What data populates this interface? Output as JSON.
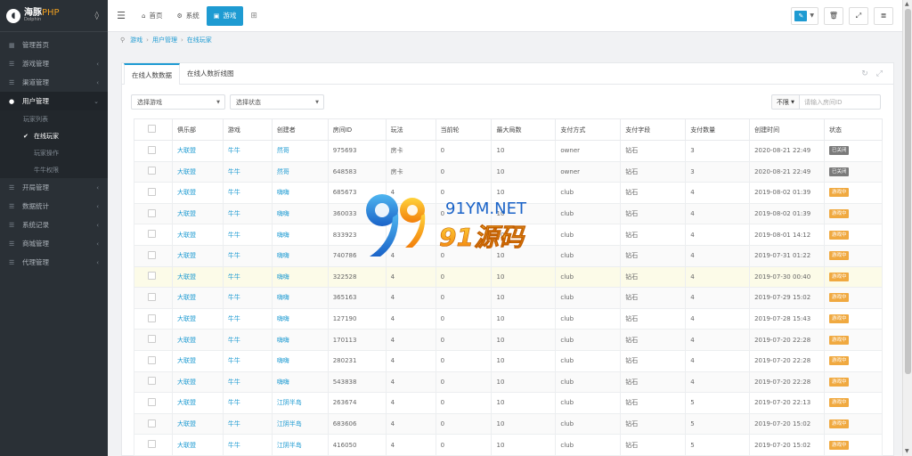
{
  "brand": {
    "name": "海豚",
    "suffix": "PHP",
    "sub": "Dolphin"
  },
  "colors": {
    "accent": "#1e9bd2",
    "closed": "#7a7a7a",
    "gaming": "#f0a940",
    "sidebar": "#2a3036"
  },
  "sidebar": {
    "items": [
      {
        "label": "管理首页",
        "icon": "grid-icon"
      },
      {
        "label": "游戏管理",
        "icon": "list-icon"
      },
      {
        "label": "渠道管理",
        "icon": "list-icon"
      },
      {
        "label": "用户管理",
        "icon": "user-icon"
      },
      {
        "label": "开局管理",
        "icon": "list-icon"
      },
      {
        "label": "数据统计",
        "icon": "list-icon"
      },
      {
        "label": "系统记录",
        "icon": "list-icon"
      },
      {
        "label": "商城管理",
        "icon": "list-icon"
      },
      {
        "label": "代理管理",
        "icon": "list-icon"
      }
    ],
    "sub_items": [
      "玩家列表",
      "在线玩家",
      "玩家操作",
      "牛牛权限"
    ]
  },
  "topbar": {
    "tabs": [
      {
        "label": "首页",
        "icon": "home-icon"
      },
      {
        "label": "系统",
        "icon": "gear-icon"
      },
      {
        "label": "游戏",
        "icon": "app-icon"
      }
    ]
  },
  "breadcrumb": [
    "游戏",
    "用户管理",
    "在线玩家"
  ],
  "panel": {
    "tabs": [
      "在线人数数据",
      "在线人数折线图"
    ],
    "filters": [
      "选择游戏",
      "选择状态"
    ],
    "search": {
      "button": "不限",
      "placeholder": "请输入房间ID"
    }
  },
  "table": {
    "headers": [
      "俱乐部",
      "游戏",
      "创建者",
      "房间ID",
      "玩法",
      "当前轮",
      "最大局数",
      "支付方式",
      "支付字段",
      "支付数量",
      "创建时间",
      "状态"
    ],
    "rows": [
      [
        "大联盟",
        "牛牛",
        "然哥",
        "975693",
        "房卡",
        "0",
        "10",
        "owner",
        "钻石",
        "3",
        "2020-08-21 22:49",
        "已关闭"
      ],
      [
        "大联盟",
        "牛牛",
        "然哥",
        "648583",
        "房卡",
        "0",
        "10",
        "owner",
        "钻石",
        "3",
        "2020-08-21 22:49",
        "已关闭"
      ],
      [
        "大联盟",
        "牛牛",
        "嗨嗨",
        "685673",
        "4",
        "0",
        "10",
        "club",
        "钻石",
        "4",
        "2019-08-02 01:39",
        "游戏中"
      ],
      [
        "大联盟",
        "牛牛",
        "嗨嗨",
        "360033",
        "4",
        "0",
        "10",
        "club",
        "钻石",
        "4",
        "2019-08-02 01:39",
        "游戏中"
      ],
      [
        "大联盟",
        "牛牛",
        "嗨嗨",
        "833923",
        "4",
        "0",
        "10",
        "club",
        "钻石",
        "4",
        "2019-08-01 14:12",
        "游戏中"
      ],
      [
        "大联盟",
        "牛牛",
        "嗨嗨",
        "740786",
        "4",
        "0",
        "10",
        "club",
        "钻石",
        "4",
        "2019-07-31 01:22",
        "游戏中"
      ],
      [
        "大联盟",
        "牛牛",
        "嗨嗨",
        "322528",
        "4",
        "0",
        "10",
        "club",
        "钻石",
        "4",
        "2019-07-30 00:40",
        "游戏中"
      ],
      [
        "大联盟",
        "牛牛",
        "嗨嗨",
        "365163",
        "4",
        "0",
        "10",
        "club",
        "钻石",
        "4",
        "2019-07-29 15:02",
        "游戏中"
      ],
      [
        "大联盟",
        "牛牛",
        "嗨嗨",
        "127190",
        "4",
        "0",
        "10",
        "club",
        "钻石",
        "4",
        "2019-07-28 15:43",
        "游戏中"
      ],
      [
        "大联盟",
        "牛牛",
        "嗨嗨",
        "170113",
        "4",
        "0",
        "10",
        "club",
        "钻石",
        "4",
        "2019-07-20 22:28",
        "游戏中"
      ],
      [
        "大联盟",
        "牛牛",
        "嗨嗨",
        "280231",
        "4",
        "0",
        "10",
        "club",
        "钻石",
        "4",
        "2019-07-20 22:28",
        "游戏中"
      ],
      [
        "大联盟",
        "牛牛",
        "嗨嗨",
        "543838",
        "4",
        "0",
        "10",
        "club",
        "钻石",
        "4",
        "2019-07-20 22:28",
        "游戏中"
      ],
      [
        "大联盟",
        "牛牛",
        "江阴半岛",
        "263674",
        "4",
        "0",
        "10",
        "club",
        "钻石",
        "5",
        "2019-07-20 22:13",
        "游戏中"
      ],
      [
        "大联盟",
        "牛牛",
        "江阴半岛",
        "683606",
        "4",
        "0",
        "10",
        "club",
        "钻石",
        "5",
        "2019-07-20 15:02",
        "游戏中"
      ],
      [
        "大联盟",
        "牛牛",
        "江阴半岛",
        "416050",
        "4",
        "0",
        "10",
        "club",
        "钻石",
        "5",
        "2019-07-20 15:02",
        "游戏中"
      ]
    ]
  },
  "watermark": {
    "text1": "91YM.NET",
    "text2": "91源码"
  }
}
